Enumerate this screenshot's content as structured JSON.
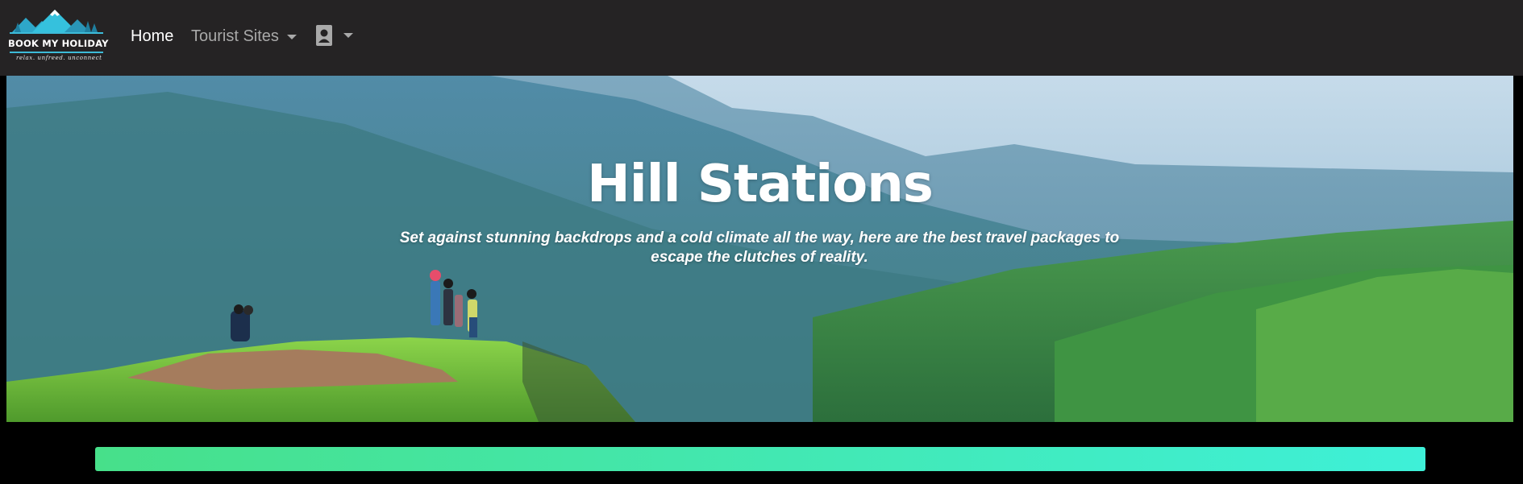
{
  "brand": {
    "name": "BOOK MY HOLIDAY",
    "tagline": "relax. unfreed. unconnect"
  },
  "nav": {
    "home_label": "Home",
    "tourist_sites_label": "Tourist Sites",
    "user_icon": "user-profile-icon"
  },
  "hero": {
    "title": "Hill Stations",
    "subtitle": "Set against stunning backdrops and a cold climate all the way, here are the best travel packages to escape the clutches of reality."
  },
  "colors": {
    "navbar_bg": "#252324",
    "page_bg": "#000000",
    "nav_active": "#ffffff",
    "nav_inactive": "#a9a9a9",
    "bar_start": "#47e08a",
    "bar_end": "#3ef0d8",
    "logo_accent": "#3dbbd8"
  }
}
